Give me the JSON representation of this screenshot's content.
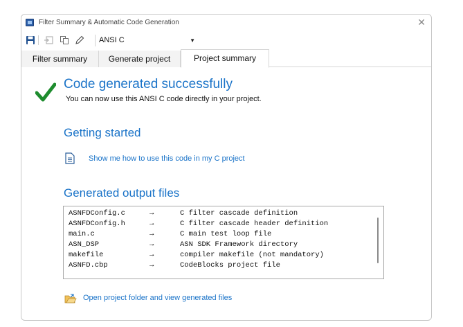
{
  "window": {
    "title": "Filter Summary & Automatic Code Generation"
  },
  "toolbar": {
    "language_select": "ANSI C",
    "icons": [
      "save-icon",
      "export-icon",
      "copy-icon",
      "edit-icon"
    ]
  },
  "tabs": [
    {
      "label": "Filter summary",
      "active": false
    },
    {
      "label": "Generate project",
      "active": false
    },
    {
      "label": "Project summary",
      "active": true
    }
  ],
  "summary": {
    "success_title": "Code generated successfully",
    "success_text": "You can now use this ANSI C code directly in your project.",
    "getting_started_title": "Getting started",
    "howto_link": "Show me how to use this code in my C project",
    "output_title": "Generated output files",
    "files": [
      {
        "name": "ASNFDConfig.c",
        "arrow": "→",
        "desc": "C filter cascade definition"
      },
      {
        "name": "ASNFDConfig.h",
        "arrow": "→",
        "desc": "C filter cascade header definition"
      },
      {
        "name": "main.c",
        "arrow": "→",
        "desc": "C main test loop file"
      },
      {
        "name": "ASN_DSP",
        "arrow": "→",
        "desc": "ASN SDK Framework directory"
      },
      {
        "name": "makefile",
        "arrow": "→",
        "desc": "compiler makefile (not mandatory)"
      },
      {
        "name": "ASNFD.cbp",
        "arrow": "→",
        "desc": "CodeBlocks project file"
      }
    ],
    "open_folder_link": "Open project folder and view generated files"
  },
  "colors": {
    "accent": "#1a73c8",
    "success": "#1e8c2e"
  }
}
